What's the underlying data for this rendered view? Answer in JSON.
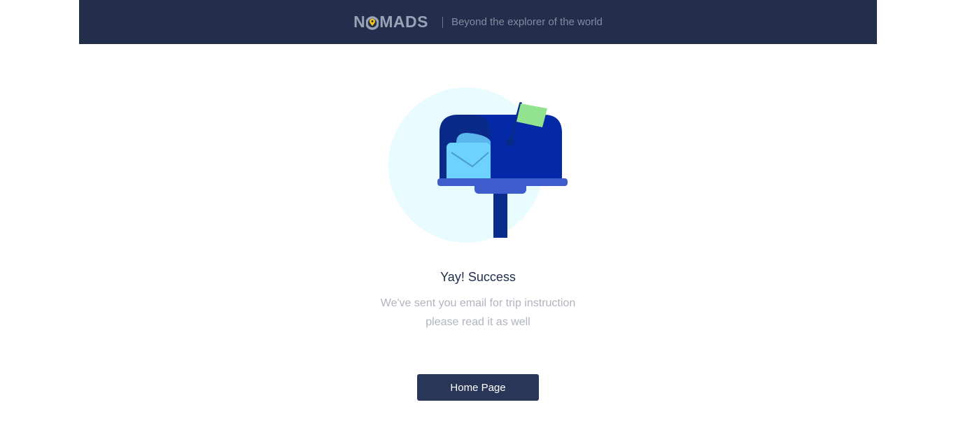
{
  "header": {
    "logo_text_start": "N",
    "logo_text_end": "MADS",
    "tagline": "Beyond the explorer of the world"
  },
  "illustration": {
    "icon": "mailbox-illustration",
    "colors": {
      "circle": "#e8fbfe",
      "mailbox": "#0429a8",
      "mailbox_dark": "#082c8c",
      "base": "#3f5ccc",
      "letter": "#6dd2ff",
      "flag": "#92e38f"
    }
  },
  "content": {
    "title": "Yay! Success",
    "message_line1": "We've sent you email for trip instruction",
    "message_line2": "please read it as well"
  },
  "actions": {
    "home_label": "Home Page"
  },
  "colors": {
    "header_bg": "#222e4b",
    "button_bg": "#2a3658"
  }
}
